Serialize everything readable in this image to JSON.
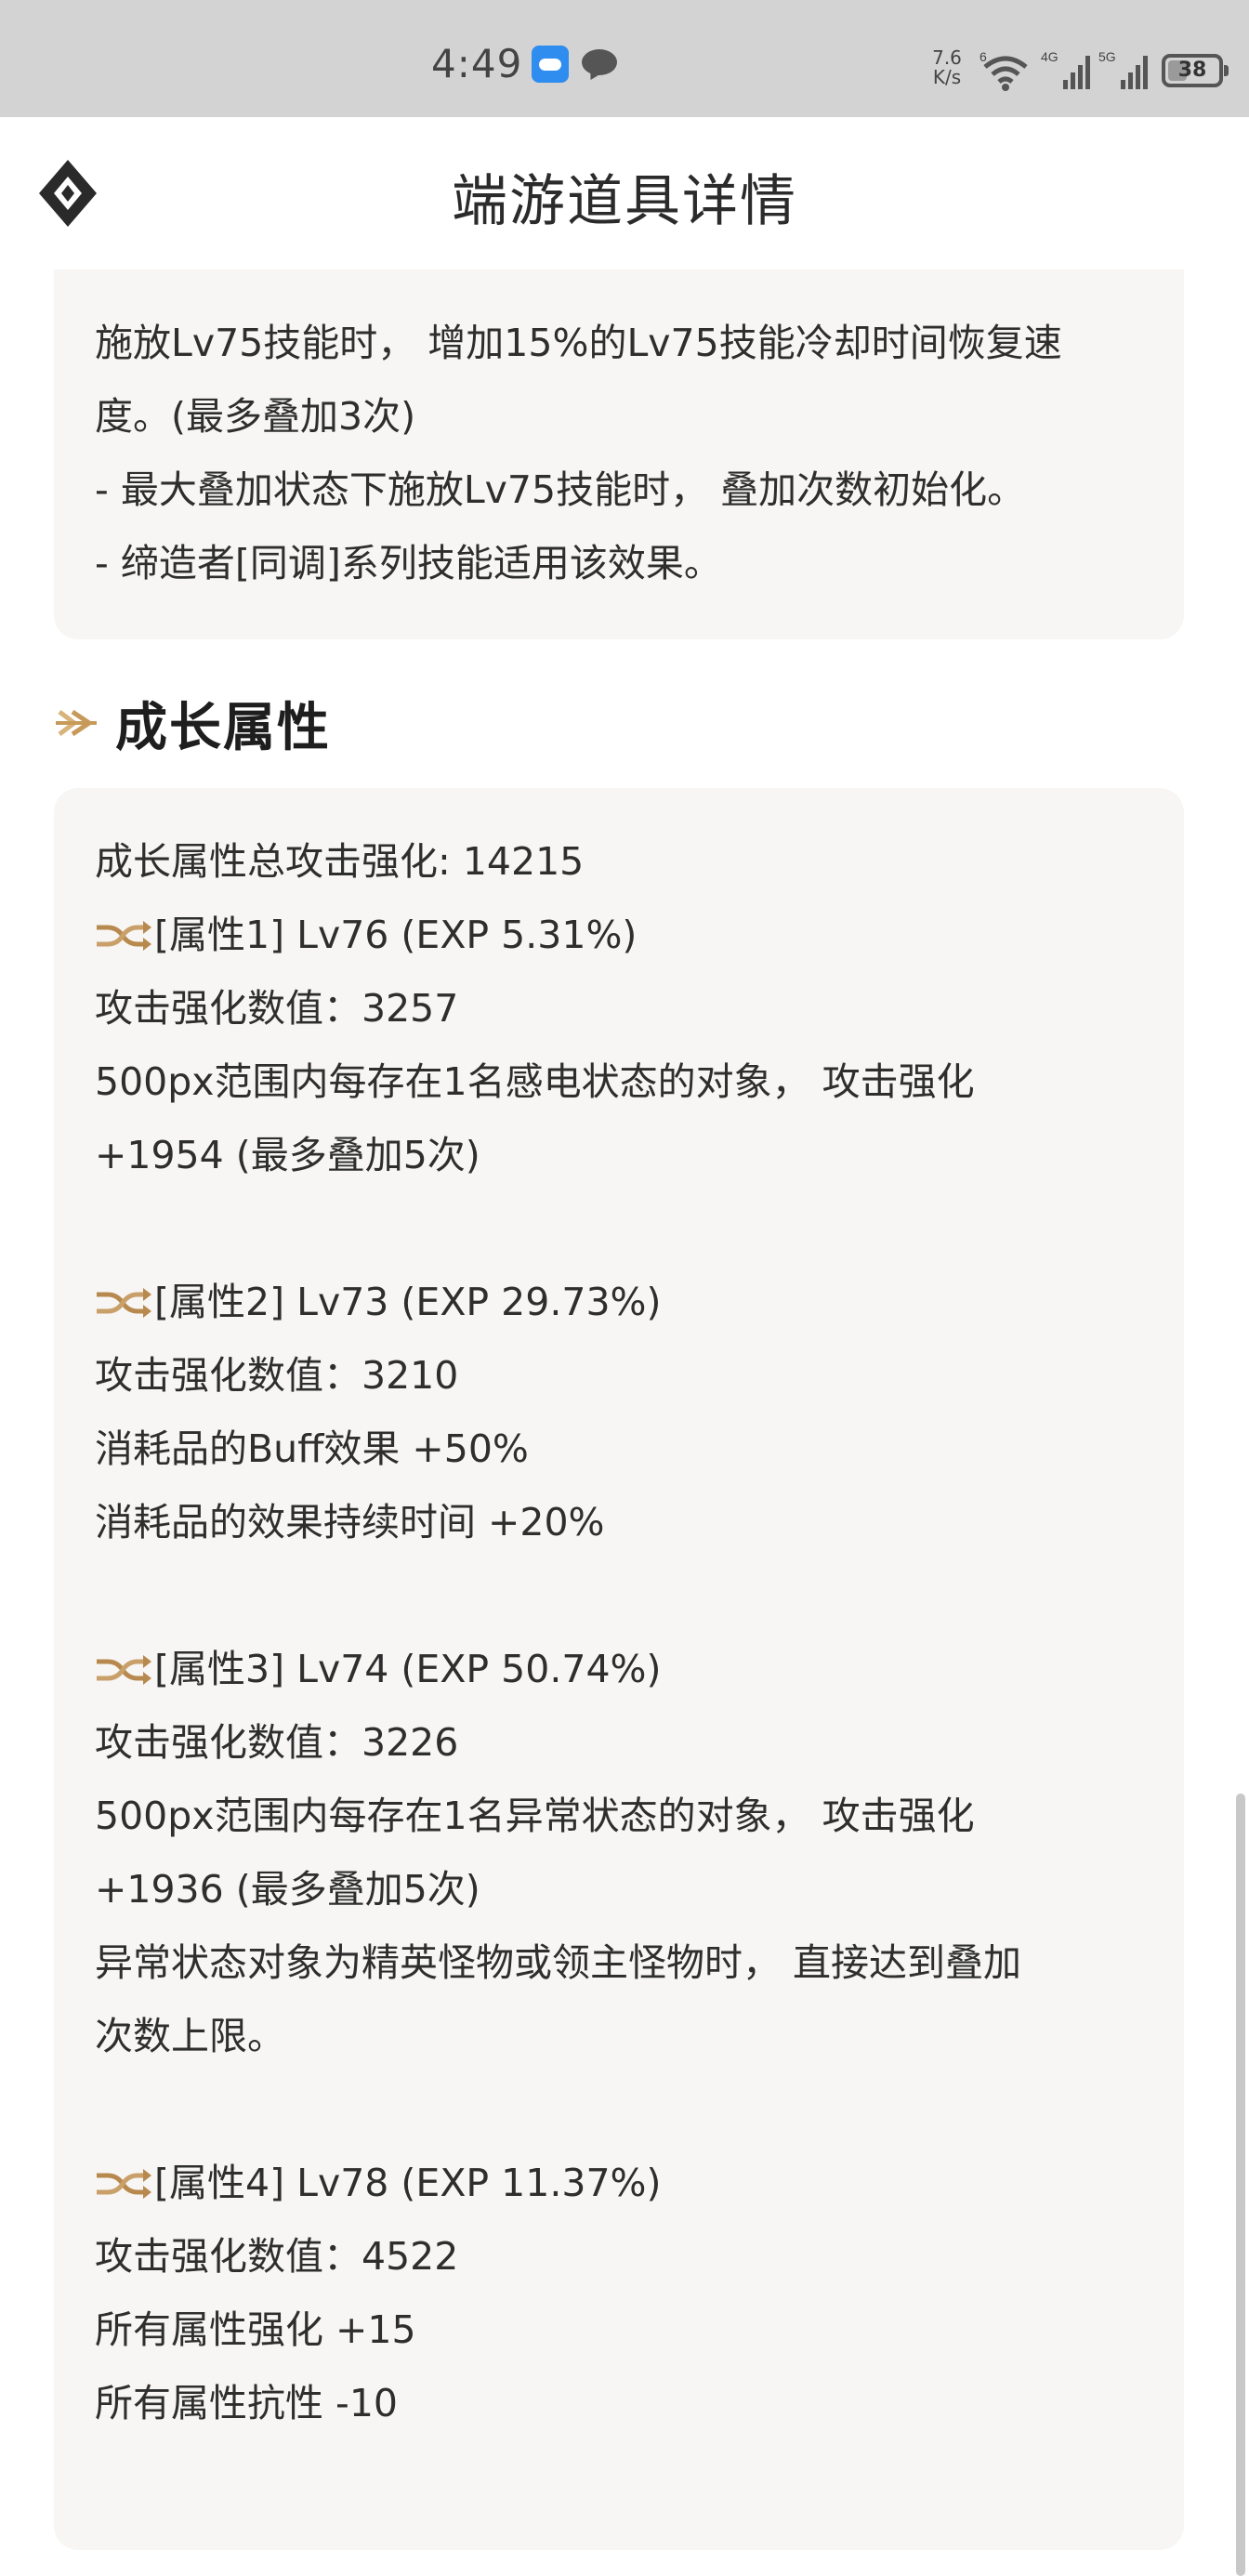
{
  "status_bar": {
    "time": "4:49",
    "net_speed_value": "7.6",
    "net_speed_unit": "K/s",
    "wifi_badge": "6",
    "sim1_badge": "4G",
    "sim2_badge": "5G",
    "battery_level": "38",
    "icons": [
      "weather-icon",
      "chat-icon",
      "wifi-icon",
      "signal-icon",
      "signal-icon",
      "battery-icon"
    ]
  },
  "header": {
    "title": "端游道具详情",
    "logo_icon": "diamond-logo-icon"
  },
  "effect_card": {
    "lines": [
      "施放Lv75技能时， 增加15%的Lv75技能冷却时间恢复速",
      "度。(最多叠加3次)",
      "- 最大叠加状态下施放Lv75技能时， 叠加次数初始化。",
      "- 缔造者[同调]系列技能适用该效果。"
    ]
  },
  "growth_section": {
    "title": "成长属性",
    "icon": "arrow-right-icon",
    "total": "成长属性总攻击强化: 14215",
    "attributes": [
      {
        "heading": "[属性1] Lv76 (EXP 5.31%)",
        "lines": [
          "攻击强化数值：3257",
          "500px范围内每存在1名感电状态的对象， 攻击强化",
          "+1954 (最多叠加5次)"
        ]
      },
      {
        "heading": "[属性2] Lv73 (EXP 29.73%)",
        "lines": [
          "攻击强化数值：3210",
          "消耗品的Buff效果 +50%",
          "消耗品的效果持续时间 +20%"
        ]
      },
      {
        "heading": "[属性3] Lv74 (EXP 50.74%)",
        "lines": [
          "攻击强化数值：3226",
          "500px范围内每存在1名异常状态的对象， 攻击强化",
          "+1936 (最多叠加5次)",
          "异常状态对象为精英怪物或领主怪物时， 直接达到叠加",
          "次数上限。"
        ]
      },
      {
        "heading": "[属性4] Lv78 (EXP 11.37%)",
        "lines": [
          "攻击强化数值：4522",
          "所有属性强化 +15",
          "所有属性抗性 -10"
        ]
      }
    ]
  },
  "colors": {
    "status_bar_bg": "#d3d3d3",
    "card_bg": "#f7f6f4",
    "accent_gold": "#c79a5a",
    "text": "#2e2e2e"
  }
}
